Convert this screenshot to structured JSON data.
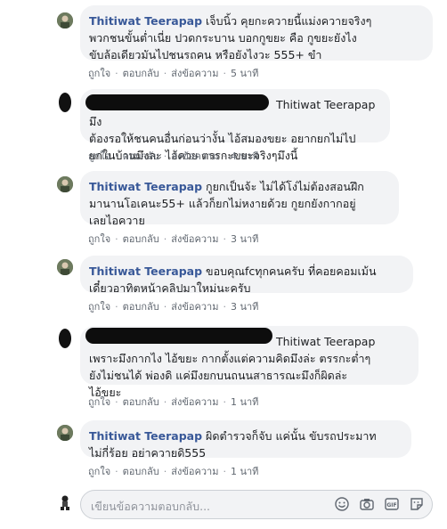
{
  "comments": [
    {
      "author": "Thitiwat Teerapap",
      "text": "เจ็บนิ้ว คุยกะควายนี้แม่งควายจริงๆ พวกชนขั้นต่ำเนี่ย ปวดกระบาน บอกกูขยะ คือ กูขยะยังไง ขับล้อเดียวมันไปชนรถคน หรือยังไงวะ 555+ ขำ",
      "lines": [
        "เจ็บนิ้ว คุยกะควายนี้แม่งควายจริงๆ",
        "พวกชนขั้นต่ำเนี่ย ปวดกระบาน บอกกูขยะ คือ กูขยะยังไง",
        "ขับล้อเดียวมันไปชนรถคน หรือยังไงวะ 555+ ขำ"
      ],
      "like": "ถูกใจ",
      "reply": "ตอบกลับ",
      "message": "ส่งข้อความ",
      "time": "5 นาที"
    },
    {
      "author": "",
      "mention": "Thitiwat Teerapap",
      "lines": [
        "มึง",
        "ต้องรอให้ชนคนอื่นก่อนว่างั้น ไอ้สมองขยะ อยากยกไม่ไป",
        "ยกในบ้านมึงละ ไอ้ควย ตรรกะขยะจริงๆมึงนี้"
      ],
      "like": "ถูกใจ",
      "reply": "ตอบกลับ",
      "message": "ส่งข้อความ",
      "time": "4 นาที"
    },
    {
      "author": "Thitiwat Teerapap",
      "lines": [
        "กูยกเป็นจ้ะ ไม่ได้โง่ไม่ต้องสอนฝึก",
        "มานานโอเคนะ55+ แล้วก็ยกไม่หงายด้วย กูยกยังกากอยู่",
        "เลยไอควาย"
      ],
      "like": "ถูกใจ",
      "reply": "ตอบกลับ",
      "message": "ส่งข้อความ",
      "time": "3 นาที"
    },
    {
      "author": "Thitiwat Teerapap",
      "lines": [
        "ขอบคุณfcทุกคนครับ ที่คอยคอมเม้น",
        "เดี๋ยวอาทิตหน้าคลิปมาใหม่นะครับ"
      ],
      "like": "ถูกใจ",
      "reply": "ตอบกลับ",
      "message": "ส่งข้อความ",
      "time": "3 นาที"
    },
    {
      "author": "",
      "mention": "Thitiwat Teerapap",
      "lines": [
        "",
        "เพราะมึงกากไง ไอ้ขยะ กากตั้งแต่ความคิดมึงล่ะ ตรรกะต่ำๆ",
        "ยังไม่ชนได้ พ่องดิ แค่มึงยกบนถนนสาธารณะมึงก็ผิดล่ะ",
        "ไอ้ขยะ"
      ],
      "like": "ถูกใจ",
      "reply": "ตอบกลับ",
      "message": "ส่งข้อความ",
      "time": "1 นาที"
    },
    {
      "author": "Thitiwat Teerapap",
      "lines": [
        "ผิดตำรวจก็จับ แค่นั้น ขับรถประมาท",
        "ไม่กี่ร้อย อย่าควายดิ555"
      ],
      "like": "ถูกใจ",
      "reply": "ตอบกลับ",
      "message": "ส่งข้อความ",
      "time": "1 นาที"
    }
  ],
  "composer": {
    "placeholder": "เขียนข้อความตอบกลับ...",
    "icons": [
      "emoji-icon",
      "camera-icon",
      "gif-icon",
      "sticker-icon"
    ]
  },
  "colors": {
    "author": "#385898",
    "bubble": "#f2f3f5",
    "meta": "#606770"
  }
}
